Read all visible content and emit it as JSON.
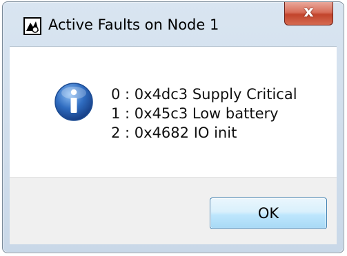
{
  "window": {
    "title": "Active Faults on Node 1",
    "app_icon": "dialog-app-icon",
    "close_icon": "close-icon",
    "close_glyph": "x"
  },
  "message": {
    "icon": "info-icon",
    "lines": [
      "0 : 0x4dc3 Supply Critical",
      "1 : 0x45c3 Low battery",
      "2 : 0x4682 IO init"
    ]
  },
  "buttons": {
    "ok_label": "OK"
  },
  "colors": {
    "info_blue": "#2f6cc0",
    "close_red": "#c2442c",
    "button_border": "#3c7fb1"
  }
}
